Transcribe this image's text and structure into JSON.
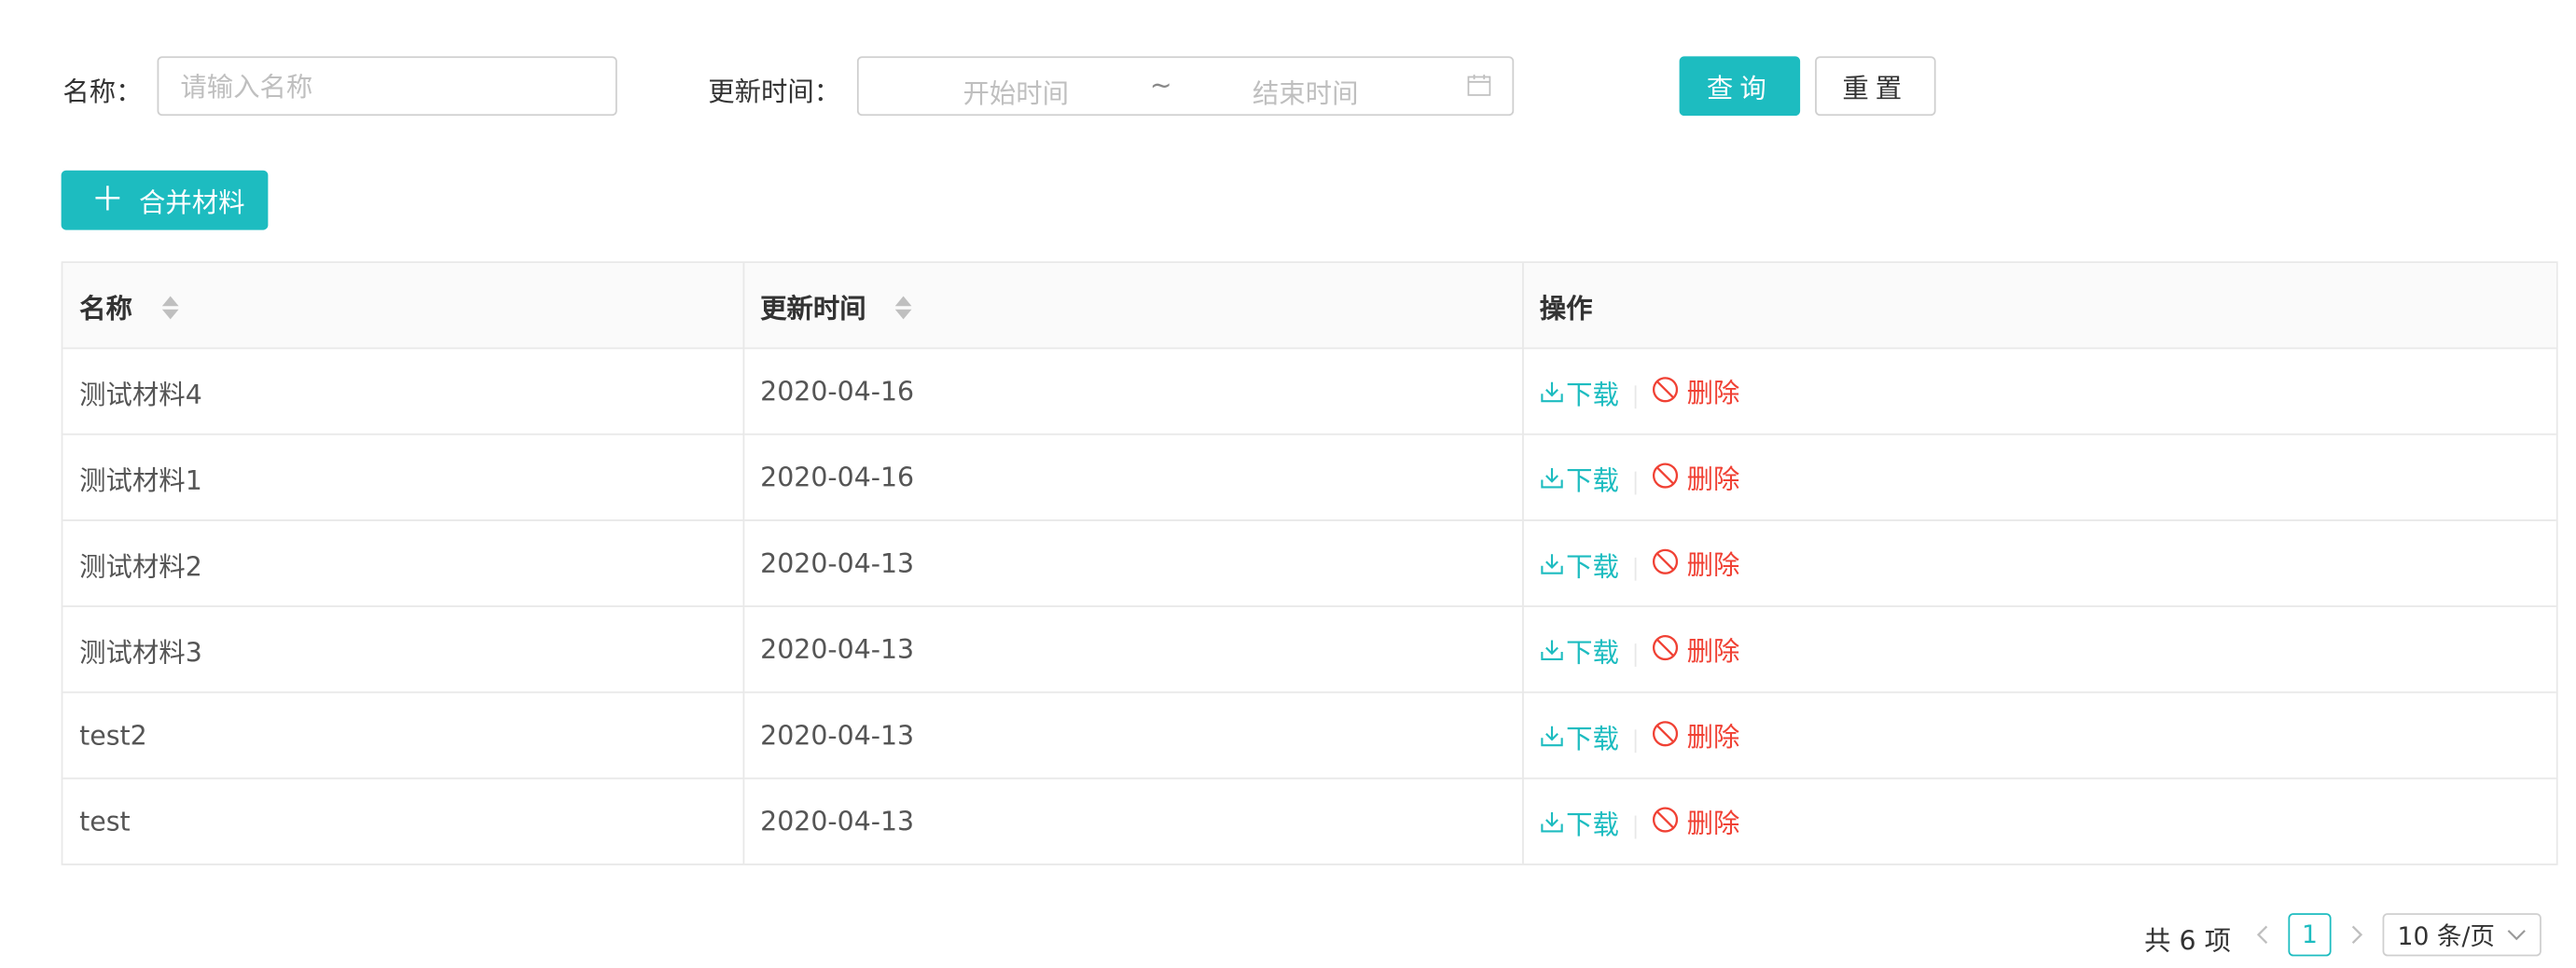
{
  "search": {
    "name_label": "名称：",
    "name_placeholder": "请输入名称",
    "time_label": "更新时间：",
    "range_start": "开始时间",
    "range_sep": "~",
    "range_end": "结束时间",
    "query_button": "查询",
    "reset_button": "重置"
  },
  "toolbar": {
    "merge_button": "合并材料"
  },
  "table": {
    "columns": [
      "名称",
      "更新时间",
      "操作"
    ],
    "action_download": "下载",
    "action_delete": "删除",
    "rows": [
      {
        "name": "测试材料4",
        "date": "2020-04-16"
      },
      {
        "name": "测试材料1",
        "date": "2020-04-16"
      },
      {
        "name": "测试材料2",
        "date": "2020-04-13"
      },
      {
        "name": "测试材料3",
        "date": "2020-04-13"
      },
      {
        "name": "test2",
        "date": "2020-04-13"
      },
      {
        "name": "test",
        "date": "2020-04-13"
      }
    ]
  },
  "pagination": {
    "total_text": "共 6 项",
    "current_page": "1",
    "page_size": "10 条/页"
  },
  "colors": {
    "primary": "#1dbcc0",
    "danger": "#f04134"
  },
  "icons": [
    "calendar-icon",
    "plus-icon",
    "sort-icon",
    "download-icon",
    "delete-icon",
    "chevron-left-icon",
    "chevron-right-icon",
    "chevron-down-icon"
  ]
}
